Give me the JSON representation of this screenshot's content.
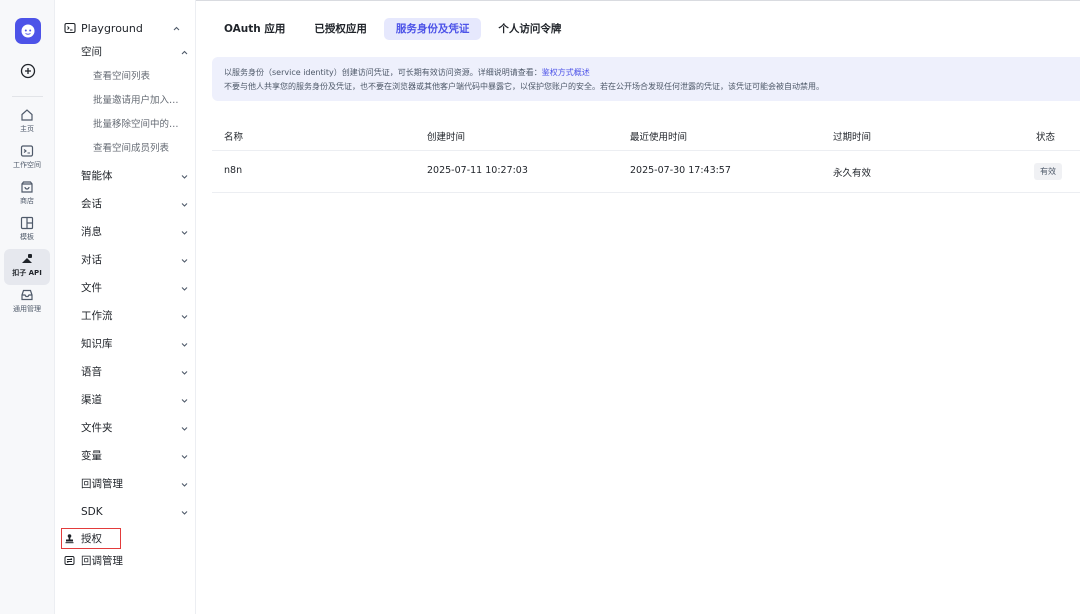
{
  "rail": {
    "items": [
      {
        "label": "主页"
      },
      {
        "label": "工作空间"
      },
      {
        "label": "商店"
      },
      {
        "label": "模板"
      },
      {
        "label": "扣子 API"
      },
      {
        "label": "通用管理"
      }
    ]
  },
  "sidebar": {
    "header": "Playground",
    "space": {
      "label": "空间",
      "children": [
        "查看空间列表",
        "批量邀请用户加入…",
        "批量移除空间中的…",
        "查看空间成员列表"
      ]
    },
    "groups": [
      "智能体",
      "会话",
      "消息",
      "对话",
      "文件",
      "工作流",
      "知识库",
      "语音",
      "渠道",
      "文件夹",
      "变量",
      "回调管理",
      "SDK"
    ],
    "auth_label": "授权",
    "callback_label": "回调管理"
  },
  "tabs": [
    "OAuth 应用",
    "已授权应用",
    "服务身份及凭证",
    "个人访问令牌"
  ],
  "notice": {
    "line1_prefix": "以服务身份（service identity）创建访问凭证，可长期有效访问资源。详细说明请查看：",
    "line1_link": "鉴权方式概述",
    "line2": "不要与他人共享您的服务身份及凭证，也不要在浏览器或其他客户端代码中暴露它，以保护您账户的安全。若在公开场合发现任何泄露的凭证，该凭证可能会被自动禁用。"
  },
  "table": {
    "headers": [
      "名称",
      "创建时间",
      "最近使用时间",
      "过期时间",
      "状态"
    ],
    "rows": [
      {
        "name": "n8n",
        "created": "2025-07-11 10:27:03",
        "last_used": "2025-07-30 17:43:57",
        "expires": "永久有效",
        "status": "有效"
      }
    ]
  },
  "colors": {
    "accent": "#4d53e8",
    "highlight_box": "#e23b3b",
    "notice_bg": "#eef0fc"
  }
}
